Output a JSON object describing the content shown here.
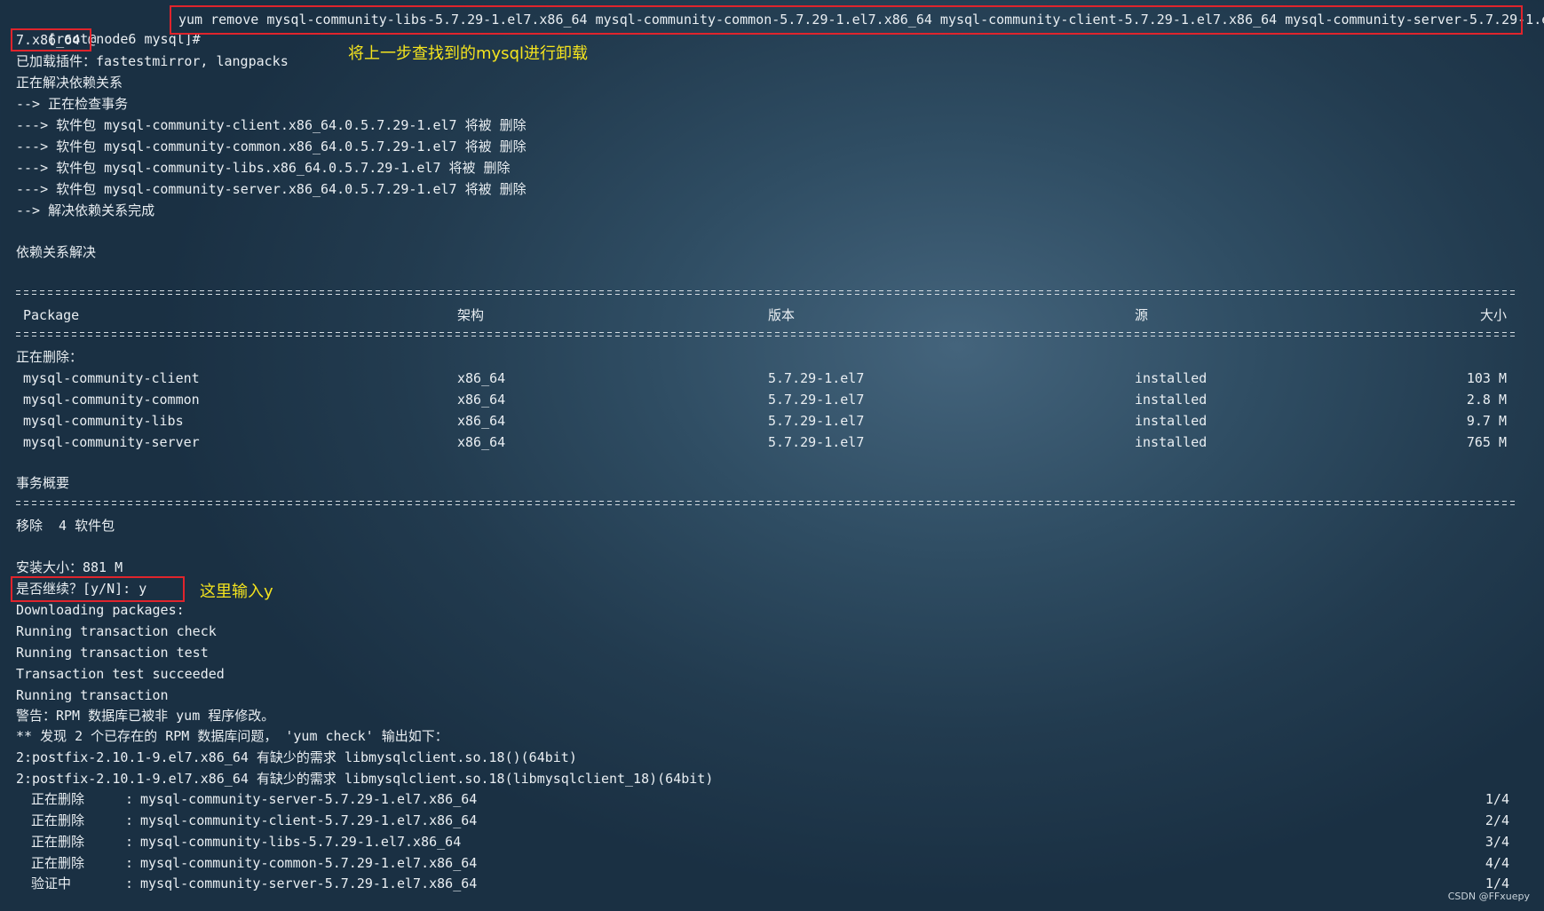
{
  "terminal": {
    "prompt": "[root@node6 mysql]#",
    "command_part1": "yum remove mysql-community-libs-5.7.29-1.el7.x86_64 mysql-community-common-5.7.29-1.el7.x86_64 mysql-community-client-5.7.29-1.el7.x86_64 mysql-community-server-5.7.29-1.el",
    "command_part2": "7.x86_64",
    "plugins_line": "已加载插件：fastestmirror, langpacks",
    "resolving_line": "正在解决依赖关系",
    "checking_line": "--> 正在检查事务",
    "remove_lines": [
      "---> 软件包 mysql-community-client.x86_64.0.5.7.29-1.el7 将被 删除",
      "---> 软件包 mysql-community-common.x86_64.0.5.7.29-1.el7 将被 删除",
      "---> 软件包 mysql-community-libs.x86_64.0.5.7.29-1.el7 将被 删除",
      "---> 软件包 mysql-community-server.x86_64.0.5.7.29-1.el7 将被 删除"
    ],
    "resolve_done_line": "--> 解决依赖关系完成",
    "deps_resolved_line": "依赖关系解决",
    "table_headers": {
      "package": "Package",
      "arch": "架构",
      "version": "版本",
      "repo": "源",
      "size": "大小"
    },
    "removing_label": "正在删除：",
    "packages": [
      {
        "name": "mysql-community-client",
        "arch": "x86_64",
        "version": "5.7.29-1.el7",
        "repo": "installed",
        "size": "103 M"
      },
      {
        "name": "mysql-community-common",
        "arch": "x86_64",
        "version": "5.7.29-1.el7",
        "repo": "installed",
        "size": "2.8 M"
      },
      {
        "name": "mysql-community-libs",
        "arch": "x86_64",
        "version": "5.7.29-1.el7",
        "repo": "installed",
        "size": "9.7 M"
      },
      {
        "name": "mysql-community-server",
        "arch": "x86_64",
        "version": "5.7.29-1.el7",
        "repo": "installed",
        "size": "765 M"
      }
    ],
    "summary_title": "事务概要",
    "remove_summary": "移除  4 软件包",
    "install_size": "安装大小：881 M",
    "confirm_prompt": "是否继续？[y/N]: y",
    "progress_lines": [
      "Downloading packages:",
      "Running transaction check",
      "Running transaction test",
      "Transaction test succeeded",
      "Running transaction",
      "警告：RPM 数据库已被非 yum 程序修改。",
      "** 发现 2 个已存在的 RPM 数据库问题， 'yum check' 输出如下：",
      "2:postfix-2.10.1-9.el7.x86_64 有缺少的需求 libmysqlclient.so.18()(64bit)",
      "2:postfix-2.10.1-9.el7.x86_64 有缺少的需求 libmysqlclient.so.18(libmysqlclient_18)(64bit)"
    ],
    "steps": [
      {
        "label": "正在删除",
        "pkg": "mysql-community-server-5.7.29-1.el7.x86_64",
        "count": "1/4"
      },
      {
        "label": "正在删除",
        "pkg": "mysql-community-client-5.7.29-1.el7.x86_64",
        "count": "2/4"
      },
      {
        "label": "正在删除",
        "pkg": "mysql-community-libs-5.7.29-1.el7.x86_64",
        "count": "3/4"
      },
      {
        "label": "正在删除",
        "pkg": "mysql-community-common-5.7.29-1.el7.x86_64",
        "count": "4/4"
      },
      {
        "label": "验证中",
        "pkg": "mysql-community-server-5.7.29-1.el7.x86_64",
        "count": "1/4"
      }
    ]
  },
  "annotations": {
    "uninstall_note": "将上一步查找到的mysql进行卸载",
    "input_note": "这里输入y",
    "box_color": "#e0242c",
    "note_color": "#f4e31e"
  },
  "watermark": "CSDN @FFxuepy"
}
